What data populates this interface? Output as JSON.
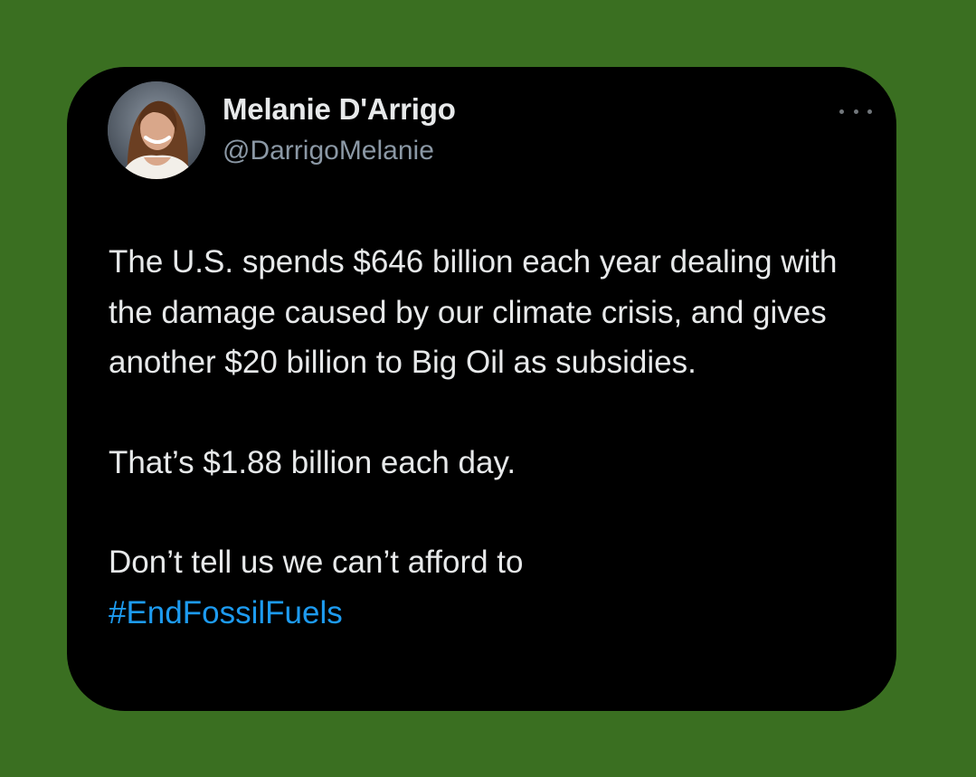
{
  "tweet": {
    "author": {
      "display_name": "Melanie D'Arrigo",
      "handle": "@DarrigoMelanie",
      "avatar_icon": "profile-photo"
    },
    "more_icon": "ellipsis-icon",
    "paragraphs": [
      "The U.S. spends $646 billion each year dealing with the damage caused by our climate crisis, and gives another $20 billion to Big Oil as subsidies.",
      "That’s $1.88 billion each day.",
      "Don’t tell us we can’t afford to"
    ],
    "hashtag": "#EndFossilFuels"
  },
  "colors": {
    "page_background": "#3a6f21",
    "card_background": "#000000",
    "text_primary": "#e7e9ea",
    "text_secondary": "#8b98a5",
    "link": "#1d9bf0"
  }
}
